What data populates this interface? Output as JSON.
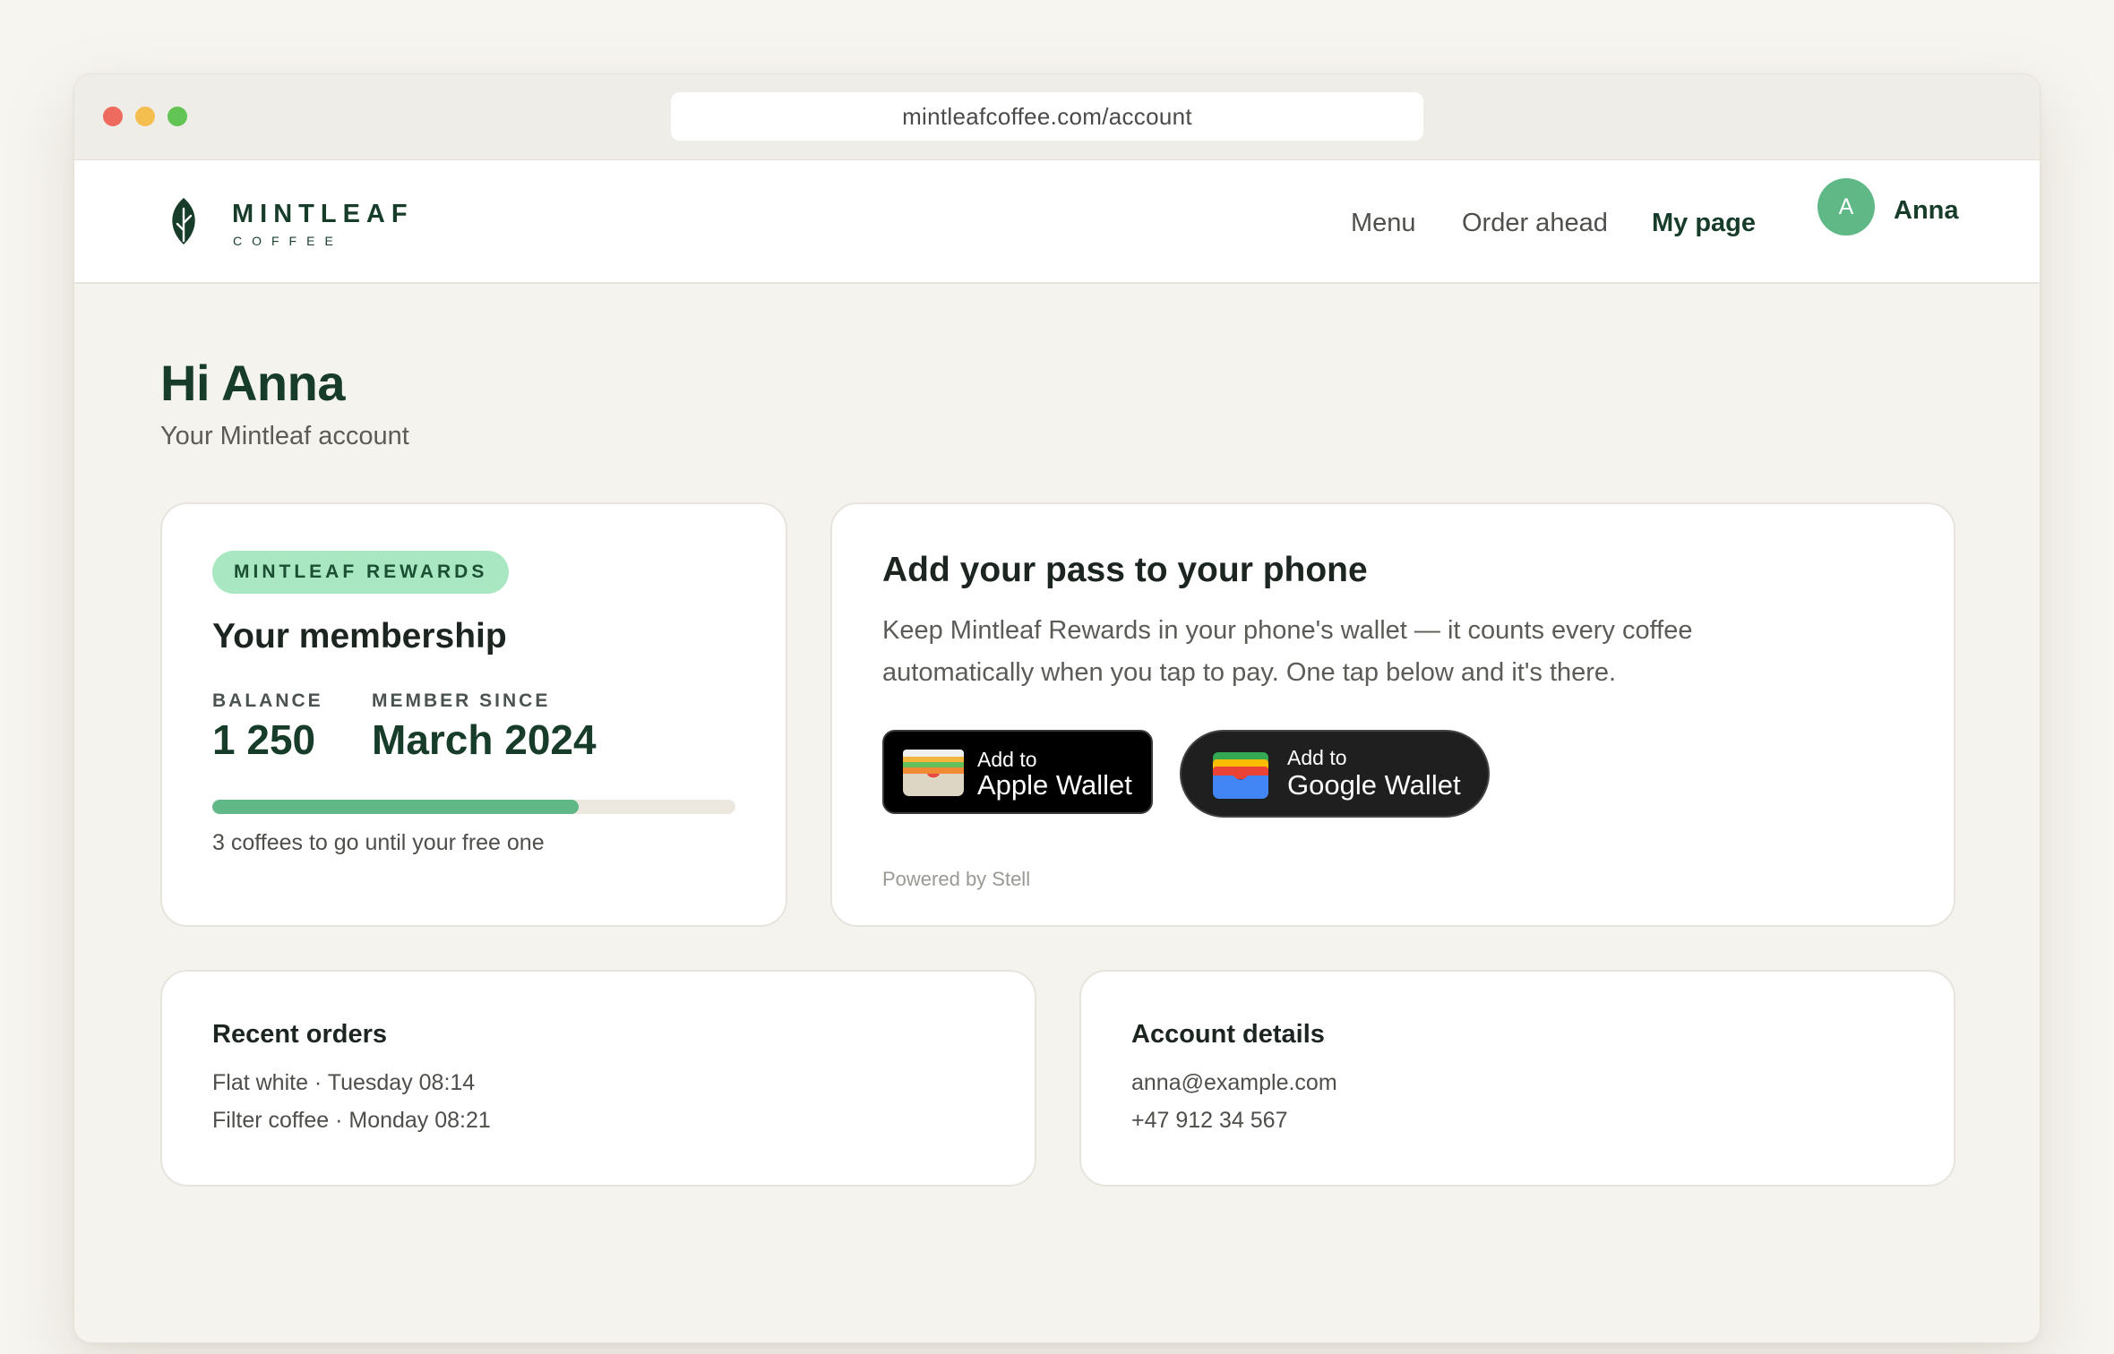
{
  "browser": {
    "url": "mintleafcoffee.com/account"
  },
  "brand": {
    "name": "MINTLEAF",
    "sub": "COFFEE"
  },
  "nav": {
    "menu": "Menu",
    "order_ahead": "Order ahead",
    "my_page": "My page",
    "avatar_initial": "A",
    "user_name": "Anna"
  },
  "page": {
    "greeting": "Hi Anna",
    "subtitle": "Your Mintleaf account"
  },
  "membership": {
    "badge": "MINTLEAF REWARDS",
    "title": "Your membership",
    "balance_label": "BALANCE",
    "balance_value": "1 250",
    "since_label": "MEMBER SINCE",
    "since_value": "March 2024",
    "progress_fraction": 0.7,
    "progress_text": "3 coffees to go until your free one"
  },
  "wallet": {
    "title": "Add your pass to your phone",
    "description": "Keep Mintleaf Rewards in your phone's wallet — it counts every coffee automatically when you tap to pay. One tap below and it's there.",
    "apple_small": "Add to",
    "apple_big": "Apple Wallet",
    "google_small": "Add to",
    "google_big": "Google Wallet",
    "powered_by": "Powered by Stell"
  },
  "orders": {
    "title": "Recent orders",
    "items": [
      "Flat white · Tuesday 08:14",
      "Filter coffee · Monday 08:21"
    ]
  },
  "account": {
    "title": "Account details",
    "email": "anna@example.com",
    "phone": "+47 912 34 567"
  },
  "colors": {
    "brand_dark": "#173d2a",
    "accent": "#5fb886",
    "badge_bg": "#a8e7c1"
  }
}
